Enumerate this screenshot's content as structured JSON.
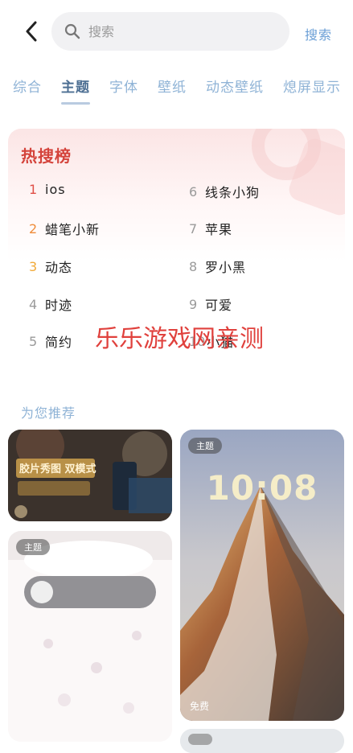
{
  "header": {
    "search_placeholder": "搜索",
    "search_action": "搜索"
  },
  "tabs": [
    {
      "label": "综合",
      "active": false
    },
    {
      "label": "主题",
      "active": true
    },
    {
      "label": "字体",
      "active": false
    },
    {
      "label": "壁纸",
      "active": false
    },
    {
      "label": "动态壁纸",
      "active": false
    },
    {
      "label": "熄屏显示",
      "active": false
    }
  ],
  "hot_search": {
    "title": "热搜榜",
    "items": [
      {
        "rank": "1",
        "text": "ios"
      },
      {
        "rank": "2",
        "text": "蜡笔小新"
      },
      {
        "rank": "3",
        "text": "动态"
      },
      {
        "rank": "4",
        "text": "时迹"
      },
      {
        "rank": "5",
        "text": "简约"
      },
      {
        "rank": "6",
        "text": "线条小狗"
      },
      {
        "rank": "7",
        "text": "苹果"
      },
      {
        "rank": "8",
        "text": "罗小黑"
      },
      {
        "rank": "9",
        "text": "可爱"
      },
      {
        "rank": "10",
        "text": "小猫"
      }
    ]
  },
  "watermark": "乐乐游戏网亲测",
  "recommend": {
    "title": "为您推荐",
    "cards": [
      {
        "tag": "",
        "image": "film-poster-image",
        "poster_text": "胶片秀图 双模式"
      },
      {
        "tag": "主题",
        "image": "mountain-lockscreen-image",
        "clock": "10:08",
        "price": "免费"
      },
      {
        "tag": "主题",
        "image": "cute-pastel-theme-image"
      },
      {
        "tag": "",
        "image": "pastel-theme-image"
      }
    ]
  },
  "colors": {
    "accent": "#6b9fd6",
    "hot_title": "#d4433b",
    "rank1": "#e05048",
    "rank2": "#ef8c3a",
    "rank3": "#f1a937"
  }
}
